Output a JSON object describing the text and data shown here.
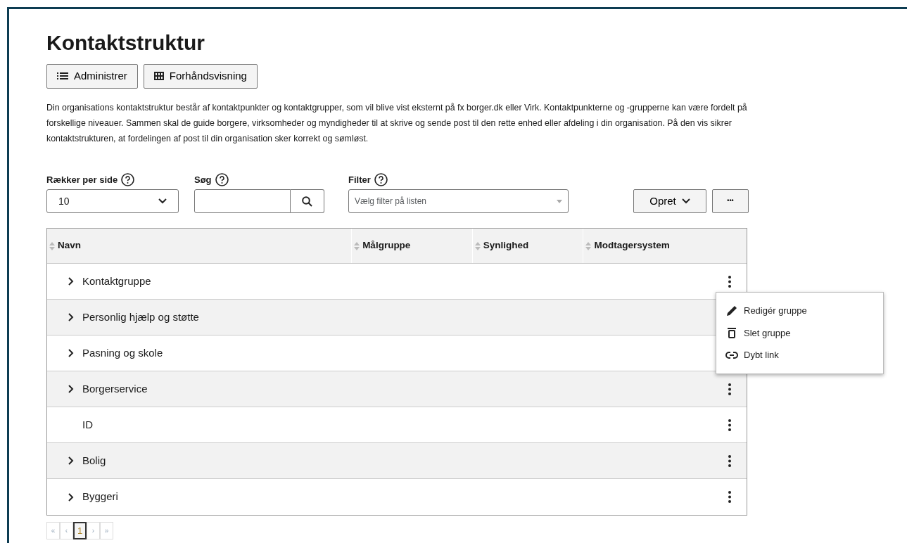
{
  "page": {
    "title": "Kontaktstruktur"
  },
  "view_buttons": [
    {
      "label": "Administrer",
      "kind": "list"
    },
    {
      "label": "Forhåndsvisning",
      "kind": "grid"
    }
  ],
  "description": "Din organisations kontaktstruktur består af kontaktpunkter og kontaktgrupper, som vil blive vist eksternt på fx borger.dk eller Virk. Kontaktpunkterne og -grupperne kan være fordelt på forskellige niveauer. Sammen skal de guide borgere, virksomheder og myndigheder til at skrive og sende post til den rette enhed eller afdeling i din organisation. På den vis sikrer kontaktstrukturen, at fordelingen af post til din organisation sker korrekt og sømløst.",
  "controls": {
    "rows_per_page": {
      "label": "Rækker per side",
      "value": "10"
    },
    "search": {
      "label": "Søg"
    },
    "filter": {
      "label": "Filter",
      "placeholder": "Vælg filter på listen"
    },
    "create_button": "Opret",
    "more_button": "•••"
  },
  "table": {
    "columns": [
      "Navn",
      "Målgruppe",
      "Synlighed",
      "Modtagersystem"
    ],
    "rows": [
      {
        "name": "Kontaktgruppe",
        "expandable": true
      },
      {
        "name": "Personlig hjælp og støtte",
        "expandable": true
      },
      {
        "name": "Pasning og skole",
        "expandable": true
      },
      {
        "name": "Borgerservice",
        "expandable": true
      },
      {
        "name": "ID",
        "expandable": false
      },
      {
        "name": "Bolig",
        "expandable": true
      },
      {
        "name": "Byggeri",
        "expandable": true
      }
    ]
  },
  "row_menu": {
    "items": [
      {
        "label": "Redigér gruppe",
        "kind": "edit"
      },
      {
        "label": "Slet gruppe",
        "kind": "delete"
      },
      {
        "label": "Dybt link",
        "kind": "link"
      }
    ]
  },
  "pagination": [
    {
      "label": "«",
      "selected": false
    },
    {
      "label": "‹",
      "selected": false
    },
    {
      "label": "1",
      "selected": true
    },
    {
      "label": "›",
      "selected": false
    },
    {
      "label": "»",
      "selected": false
    }
  ]
}
